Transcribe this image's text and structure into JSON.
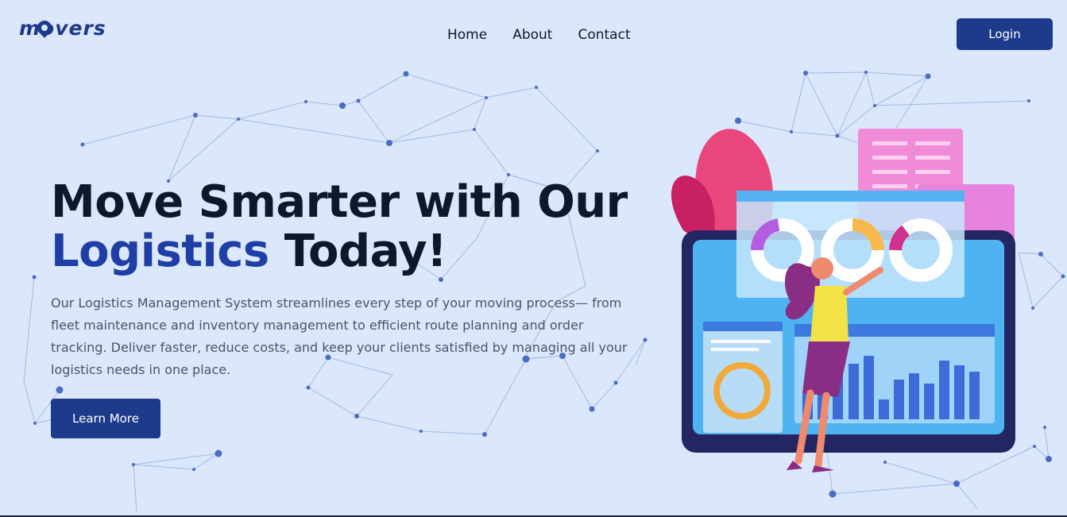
{
  "header": {
    "logo_text": "movers",
    "nav": [
      "Home",
      "About",
      "Contact"
    ],
    "login_label": "Login"
  },
  "hero": {
    "headline_line1": "Move Smarter with Our",
    "headline_accent": "Logistics",
    "headline_rest": " Today!",
    "description": "Our Logistics Management System streamlines every step of your moving process— from fleet maintenance and inventory management to efficient route planning and order tracking. Deliver faster, reduce costs, and keep your clients satisfied by managing all your logistics needs in one place.",
    "cta_label": "Learn More"
  },
  "colors": {
    "background": "#dbe7fb",
    "brand": "#1e3a8a",
    "accent_text": "#1e3fa6"
  },
  "icons": [
    "location-pin-icon"
  ]
}
